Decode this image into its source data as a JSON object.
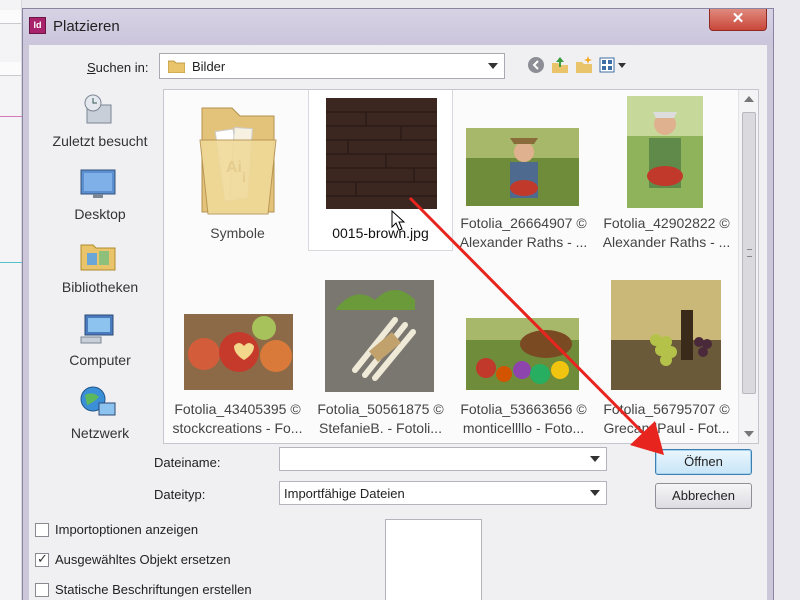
{
  "window": {
    "title": "Platzieren",
    "app_icon": "Id",
    "close_symbol": "✕"
  },
  "lookin": {
    "label_prefix": "S",
    "label_rest": "uchen in:",
    "value": "Bilder"
  },
  "toolbar": {
    "icons": [
      "back-icon",
      "up-folder-icon",
      "new-folder-icon",
      "view-menu-icon"
    ]
  },
  "places": [
    {
      "label": "Zuletzt besucht",
      "icon": "recent-places-icon"
    },
    {
      "label": "Desktop",
      "icon": "desktop-icon"
    },
    {
      "label": "Bibliotheken",
      "icon": "libraries-icon"
    },
    {
      "label": "Computer",
      "icon": "computer-icon"
    },
    {
      "label": "Netzwerk",
      "icon": "network-icon"
    }
  ],
  "files": [
    {
      "line1": "Symbole",
      "line2": "",
      "kind": "folder"
    },
    {
      "line1": "0015-brown.jpg",
      "line2": "",
      "kind": "image",
      "selected": true
    },
    {
      "line1": "Fotolia_26664907 ©",
      "line2": "Alexander Raths - ...",
      "kind": "image"
    },
    {
      "line1": "Fotolia_42902822 ©",
      "line2": "Alexander Raths - ...",
      "kind": "image"
    },
    {
      "line1": "Fotolia_43405395 ©",
      "line2": "stockcreations - Fo...",
      "kind": "image"
    },
    {
      "line1": "Fotolia_50561875 ©",
      "line2": "StefanieB. - Fotoli...",
      "kind": "image"
    },
    {
      "line1": "Fotolia_53663656 ©",
      "line2": "monticellllo - Foto...",
      "kind": "image"
    },
    {
      "line1": "Fotolia_56795707 ©",
      "line2": "GrecandPaul - Fot...",
      "kind": "image"
    }
  ],
  "form": {
    "filename_label": "Dateiname:",
    "filename_value": "",
    "filetype_label": "Dateityp:",
    "filetype_value": "Importfähige Dateien",
    "open_button": "Öffnen",
    "cancel_button": "Abbrechen"
  },
  "options": [
    {
      "label": "Importoptionen anzeigen",
      "checked": false
    },
    {
      "label": "Ausgewähltes Objekt ersetzen",
      "checked": true
    },
    {
      "label": "Statische Beschriftungen erstellen",
      "checked": false
    }
  ],
  "colors": {
    "annotation_arrow": "#e8241f",
    "dialog_frame": "#cdc7da",
    "close_button": "#c9473a",
    "default_button": "#3c7fb1"
  }
}
